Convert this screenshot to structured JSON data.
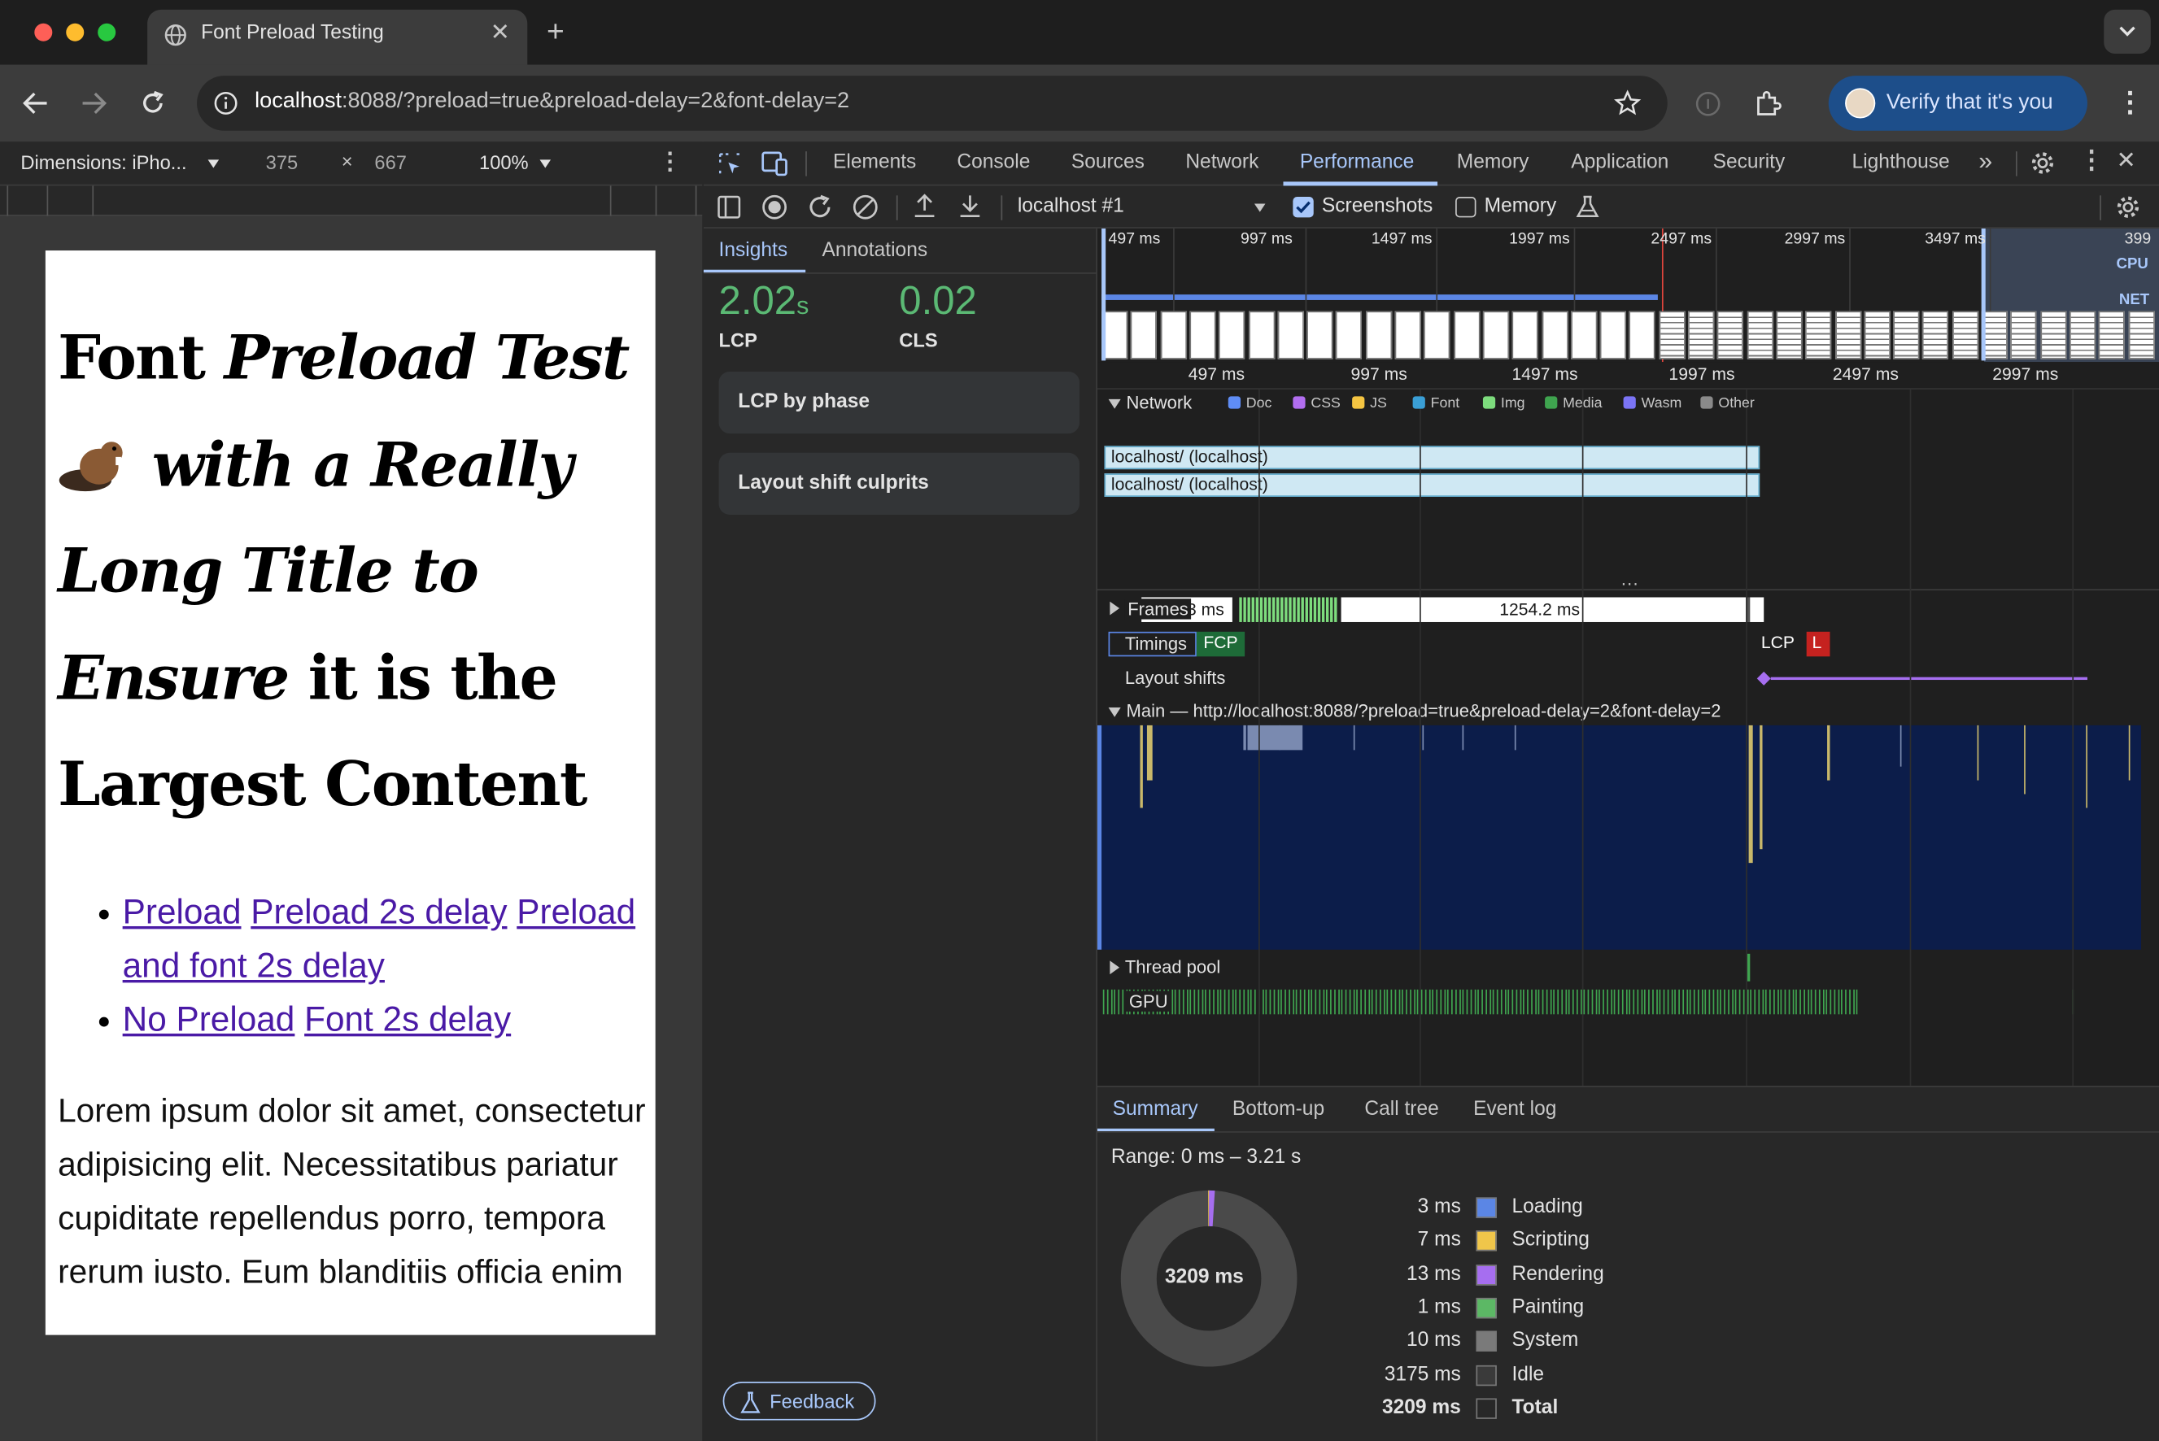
{
  "browser": {
    "tab_title": "Font Preload Testing",
    "url_host": "localhost",
    "url_rest": ":8088/?preload=true&preload-delay=2&font-delay=2",
    "profile_label": "Verify that it's you"
  },
  "device_toolbar": {
    "dimensions_label": "Dimensions: iPho...",
    "width": "375",
    "times": "×",
    "height": "667",
    "zoom": "100%"
  },
  "page": {
    "heading_parts": [
      "Font ",
      "Preload Test",
      " with a Really Long Title to Ensure",
      " it is the Largest Content"
    ],
    "heading_line1_a": "Font ",
    "heading_line1_b": "Preload Test",
    "heading_line2": "with a Really",
    "heading_line3": "Long Title to",
    "heading_line4_a": "Ensure",
    "heading_line4_b": " it is the",
    "heading_line5": "Largest Content",
    "links": [
      "Preload",
      "Preload 2s delay",
      "Preload and font 2s delay",
      "No Preload",
      "Font 2s delay"
    ],
    "paragraph": "Lorem ipsum dolor sit amet, consectetur adipisicing elit. Necessitatibus pariatur cupiditate repellendus porro, tempora rerum iusto. Eum blanditiis officia enim"
  },
  "devtools": {
    "tabs": [
      "Elements",
      "Console",
      "Sources",
      "Network",
      "Performance",
      "Memory",
      "Application",
      "Security",
      "Lighthouse"
    ],
    "active_tab": "Performance",
    "recording": "localhost #1",
    "screenshots_label": "Screenshots",
    "screenshots_checked": true,
    "memory_label": "Memory",
    "memory_checked": false
  },
  "sidebar": {
    "tabs": [
      "Insights",
      "Annotations"
    ],
    "lcp_value": "2.02",
    "lcp_unit": "s",
    "lcp_label": "LCP",
    "cls_value": "0.02",
    "cls_label": "CLS",
    "cards": [
      "LCP by phase",
      "Layout shift culprits"
    ],
    "feedback": "Feedback"
  },
  "timeline": {
    "overview_ticks": [
      "497 ms",
      "997 ms",
      "1497 ms",
      "1997 ms",
      "2497 ms",
      "2997 ms",
      "3497 ms",
      "399"
    ],
    "detail_ticks": [
      "497 ms",
      "997 ms",
      "1497 ms",
      "1997 ms",
      "2497 ms",
      "2997 ms"
    ],
    "cpu_label": "CPU",
    "net_label": "NET",
    "network_label": "Network",
    "legend": [
      {
        "label": "Doc",
        "color": "#5f8df5"
      },
      {
        "label": "CSS",
        "color": "#b26ef0"
      },
      {
        "label": "JS",
        "color": "#f5c542"
      },
      {
        "label": "Font",
        "color": "#3a9fd6"
      },
      {
        "label": "Img",
        "color": "#7ddc7d"
      },
      {
        "label": "Media",
        "color": "#3fa44f"
      },
      {
        "label": "Wasm",
        "color": "#7b74f5"
      },
      {
        "label": "Other",
        "color": "#8a8a8a"
      }
    ],
    "requests": [
      "localhost/ (localhost)",
      "localhost/ (localhost)"
    ],
    "frames_label": "Frames",
    "frames_short": "3 ms",
    "frames_long": "1254.2 ms",
    "timings_label": "Timings",
    "fcp": "FCP",
    "lcp": "LCP",
    "l_badge": "L",
    "layout_shifts_label": "Layout shifts",
    "main_label": "Main — http://localhost:8088/?preload=true&preload-delay=2&font-delay=2",
    "thread_pool_label": "Thread pool",
    "gpu_label": "GPU"
  },
  "summary": {
    "tabs": [
      "Summary",
      "Bottom-up",
      "Call tree",
      "Event log"
    ],
    "range": "Range: 0 ms – 3.21 s",
    "donut_total": "3209 ms",
    "rows": [
      {
        "value": "3 ms",
        "label": "Loading",
        "color": "#5b86e5"
      },
      {
        "value": "7 ms",
        "label": "Scripting",
        "color": "#f0c64a"
      },
      {
        "value": "13 ms",
        "label": "Rendering",
        "color": "#a66ef0"
      },
      {
        "value": "1 ms",
        "label": "Painting",
        "color": "#5cb865"
      },
      {
        "value": "10 ms",
        "label": "System",
        "color": "#7a7a7a"
      },
      {
        "value": "3175 ms",
        "label": "Idle",
        "color": "#3a3a3a"
      },
      {
        "value": "3209 ms",
        "label": "Total",
        "color": "#282828"
      }
    ]
  }
}
